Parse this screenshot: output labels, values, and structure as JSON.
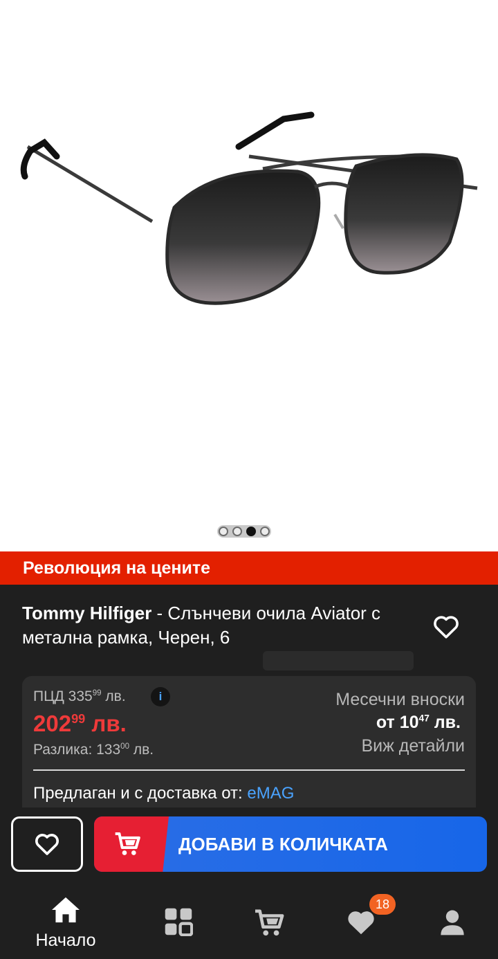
{
  "gallery": {
    "image_alt": "",
    "dots_count": 4,
    "active_index": 2
  },
  "promo": {
    "text": "Революция на цените"
  },
  "product": {
    "brand": "Tommy Hilfiger",
    "title_rest": " - Слънчеви очила Aviator с метална рамка, Черен, 6"
  },
  "price": {
    "pcd_label": "ПЦД 335",
    "pcd_cents": "99",
    "pcd_currency": " лв.",
    "info_icon": "i",
    "main_int": "202",
    "main_cents": "99",
    "main_currency": " лв.",
    "diff_label": "Разлика: 133",
    "diff_cents": "00",
    "diff_currency": " лв."
  },
  "installments": {
    "label": "Месечни вноски",
    "amount_prefix": "от 10",
    "amount_cents": "47",
    "amount_currency": " лв.",
    "details_link": "Виж детайли"
  },
  "seller": {
    "label": "Предлаган и с доставка от: ",
    "name": "eMAG"
  },
  "actions": {
    "add_to_cart": "ДОБАВИ В КОЛИЧКАТА"
  },
  "nav": {
    "home_label": "Начало",
    "favorites_badge": "18"
  },
  "colors": {
    "promo_red": "#e32000",
    "price_red": "#ef3a3a",
    "link_blue": "#4aa3ff",
    "cart_blue": "#1766e8",
    "badge_orange": "#f26323",
    "background": "#1f1f1f"
  },
  "icons": [
    "heart-icon",
    "cart-icon",
    "home-icon",
    "categories-icon",
    "user-icon",
    "info-icon"
  ]
}
